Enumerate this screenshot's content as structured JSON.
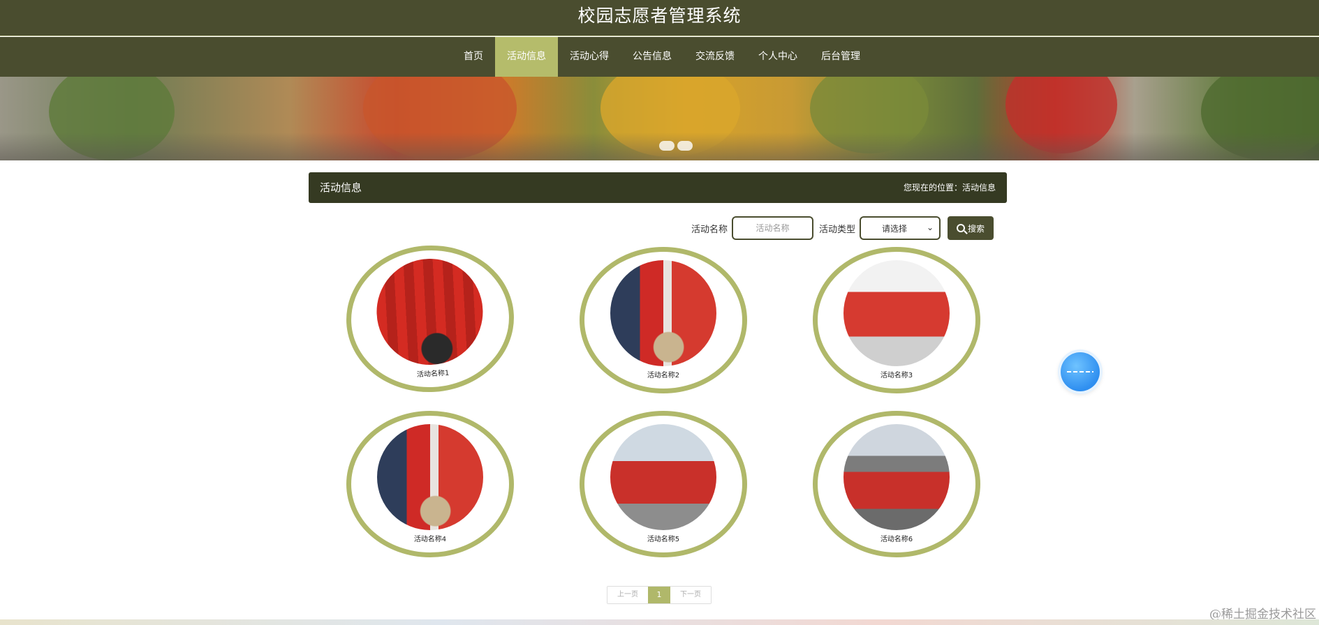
{
  "site": {
    "title": "校园志愿者管理系统"
  },
  "nav": {
    "items": [
      {
        "label": "首页",
        "active": false
      },
      {
        "label": "活动信息",
        "active": true
      },
      {
        "label": "活动心得",
        "active": false
      },
      {
        "label": "公告信息",
        "active": false
      },
      {
        "label": "交流反馈",
        "active": false
      },
      {
        "label": "个人中心",
        "active": false
      },
      {
        "label": "后台管理",
        "active": false
      }
    ]
  },
  "section": {
    "title": "活动信息",
    "breadcrumb": "您现在的位置：活动信息"
  },
  "search": {
    "name_label": "活动名称",
    "name_placeholder": "活动名称",
    "type_label": "活动类型",
    "type_selected": "请选择",
    "button_label": "搜索"
  },
  "activities": [
    {
      "name": "活动名称1",
      "photo_icon": "volunteers-red-banner-photo"
    },
    {
      "name": "活动名称2",
      "photo_icon": "volunteers-donation-photo"
    },
    {
      "name": "活动名称3",
      "photo_icon": "volunteer-group-photo"
    },
    {
      "name": "活动名称4",
      "photo_icon": "volunteers-donation-photo"
    },
    {
      "name": "活动名称5",
      "photo_icon": "volunteer-street-group-photo"
    },
    {
      "name": "活动名称6",
      "photo_icon": "volunteer-flag-photo"
    }
  ],
  "pager": {
    "prev": "上一页",
    "current": "1",
    "next": "下一页"
  },
  "watermark": "@稀土掘金技术社区",
  "colors": {
    "header": "#4a4d2f",
    "accent": "#b0b86a",
    "section_bar": "#353a22"
  }
}
